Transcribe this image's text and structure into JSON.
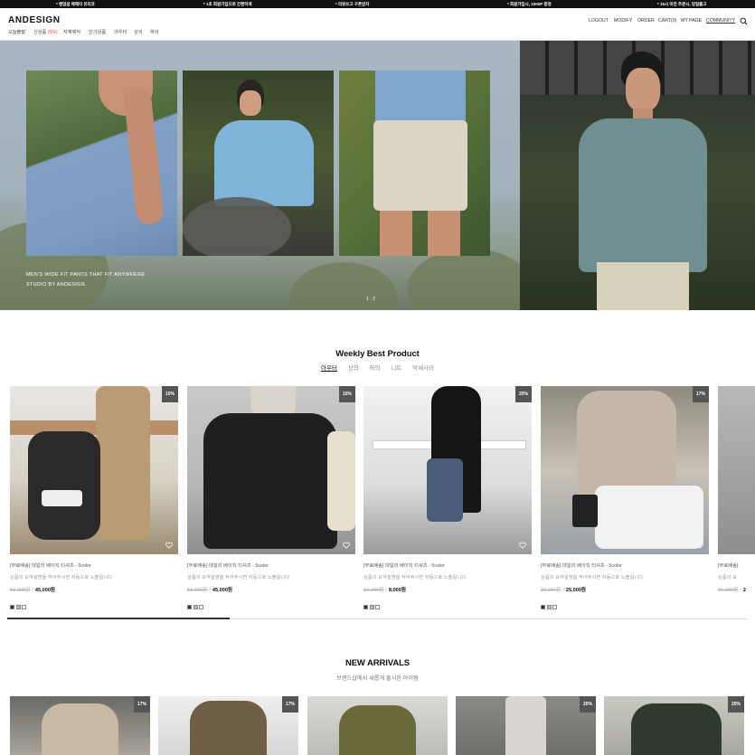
{
  "announcement": [
    "* 랜덤섬 배깨이 유리코",
    "* 1초 회원가입으로 간편하게",
    "* 리뷰쓰고 구폰받자",
    "* 회원가입시, 1000P 증정",
    "* 15시 이전 주문시, 당일출고"
  ],
  "header": {
    "logo": "ANDESIGN",
    "categories": [
      {
        "label": "오늘출발",
        "highlight": ""
      },
      {
        "label": "신상품",
        "highlight": "(5%)"
      },
      {
        "label": "자체제작",
        "highlight": ""
      },
      {
        "label": "인기상품",
        "highlight": ""
      },
      {
        "label": "아우터",
        "highlight": ""
      },
      {
        "label": "상의",
        "highlight": ""
      },
      {
        "label": "하의",
        "highlight": ""
      }
    ],
    "util": [
      "LOGOUT",
      "MODIFY",
      "ORDER",
      "CART(0)",
      "MY PAGE",
      "COMMUNITY"
    ]
  },
  "hero": {
    "caption_line1": "MEN'S WIDE FIT PANTS THAT FIT ANYWHERE",
    "caption_line2": "STUDIO BY ANDESIGN.",
    "pagination": "1 · 2"
  },
  "weekly": {
    "title": "Weekly Best Product",
    "tabs": [
      "아우터",
      "상의",
      "하의",
      "니트",
      "악세사리"
    ],
    "active_tab": 0,
    "products": [
      {
        "badge": "10%",
        "name": "[무료배송] 데일리 베이직 티셔츠 - 5color",
        "desc": "상품의 요약설명을 적어주시면 자동으로 노출됩니다",
        "old_price": "50,000원",
        "price": "45,000원"
      },
      {
        "badge": "10%",
        "name": "[무료배송] 데일리 베이직 티셔츠 - 5color",
        "desc": "상품의 요약설명을 적어주시면 자동으로 노출됩니다",
        "old_price": "50,000원",
        "price": "45,000원"
      },
      {
        "badge": "20%",
        "name": "[무료배송] 데일리 베이직 티셔츠 - 5color",
        "desc": "상품의 요약설명을 적어주시면 자동으로 노출됩니다",
        "old_price": "10,000원",
        "price": "8,000원"
      },
      {
        "badge": "17%",
        "name": "[무료배송] 데일리 베이직 티셔츠 - 5color",
        "desc": "상품의 요약설명을 적어주시면 자동으로 노출됩니다",
        "old_price": "30,000원",
        "price": "25,000원"
      },
      {
        "badge": "",
        "name": "[무료배송]",
        "desc": "상품의 요",
        "old_price": "30,000원",
        "price": "2"
      }
    ],
    "carousel_progress": 0.3
  },
  "new_arrivals": {
    "title": "NEW ARRIVALS",
    "subtitle": "브랜드샵에서 새롭게 출시한 아이템",
    "badges": [
      "17%",
      "17%",
      "",
      "20%",
      "20%"
    ]
  },
  "colors": {
    "accent": "#e04848",
    "badge": "#555555",
    "topbar": "#111111"
  },
  "icons": [
    "search-icon",
    "heart-icon"
  ]
}
